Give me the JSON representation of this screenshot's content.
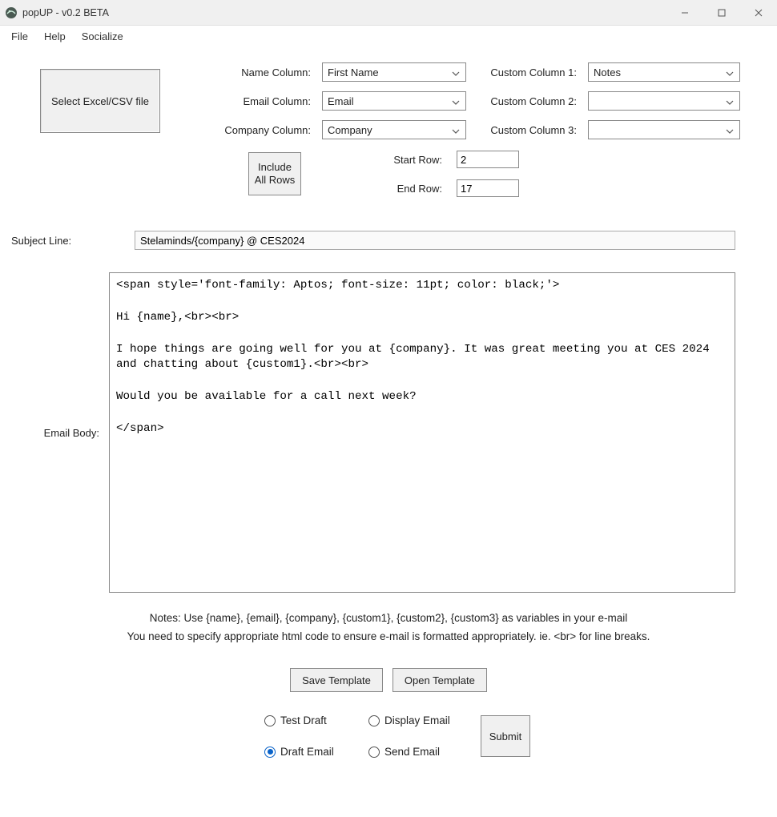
{
  "window": {
    "title": "popUP - v0.2 BETA"
  },
  "menu": {
    "file": "File",
    "help": "Help",
    "socialize": "Socialize"
  },
  "select_file_btn": "Select Excel/CSV file",
  "labels": {
    "name_col": "Name Column:",
    "email_col": "Email Column:",
    "company_col": "Company Column:",
    "custom1": "Custom Column 1:",
    "custom2": "Custom Column 2:",
    "custom3": "Custom Column 3:",
    "start_row": "Start Row:",
    "end_row": "End Row:",
    "subject": "Subject Line:",
    "body": "Email Body:"
  },
  "combos": {
    "name": "First Name",
    "email": "Email",
    "company": "Company",
    "custom1": "Notes",
    "custom2": "",
    "custom3": ""
  },
  "include_btn": "Include\nAll Rows",
  "rows": {
    "start": "2",
    "end": "17"
  },
  "subject_value": "Stelaminds/{company} @ CES2024",
  "body_value": "<span style='font-family: Aptos; font-size: 11pt; color: black;'>\n\nHi {name},<br><br>\n\nI hope things are going well for you at {company}. It was great meeting you at CES 2024 and chatting about {custom1}.<br><br>\n\nWould you be available for a call next week?\n\n</span>",
  "notes": {
    "line1": "Notes: Use {name}, {email}, {company}, {custom1}, {custom2}, {custom3} as variables in your e-mail",
    "line2": "You need to specify appropriate html code to ensure e-mail is formatted appropriately. ie. <br> for line breaks."
  },
  "buttons": {
    "save_tpl": "Save Template",
    "open_tpl": "Open Template",
    "submit": "Submit"
  },
  "radios": {
    "test_draft": "Test Draft",
    "display_email": "Display Email",
    "draft_email": "Draft Email",
    "send_email": "Send Email",
    "selected": "draft_email"
  }
}
